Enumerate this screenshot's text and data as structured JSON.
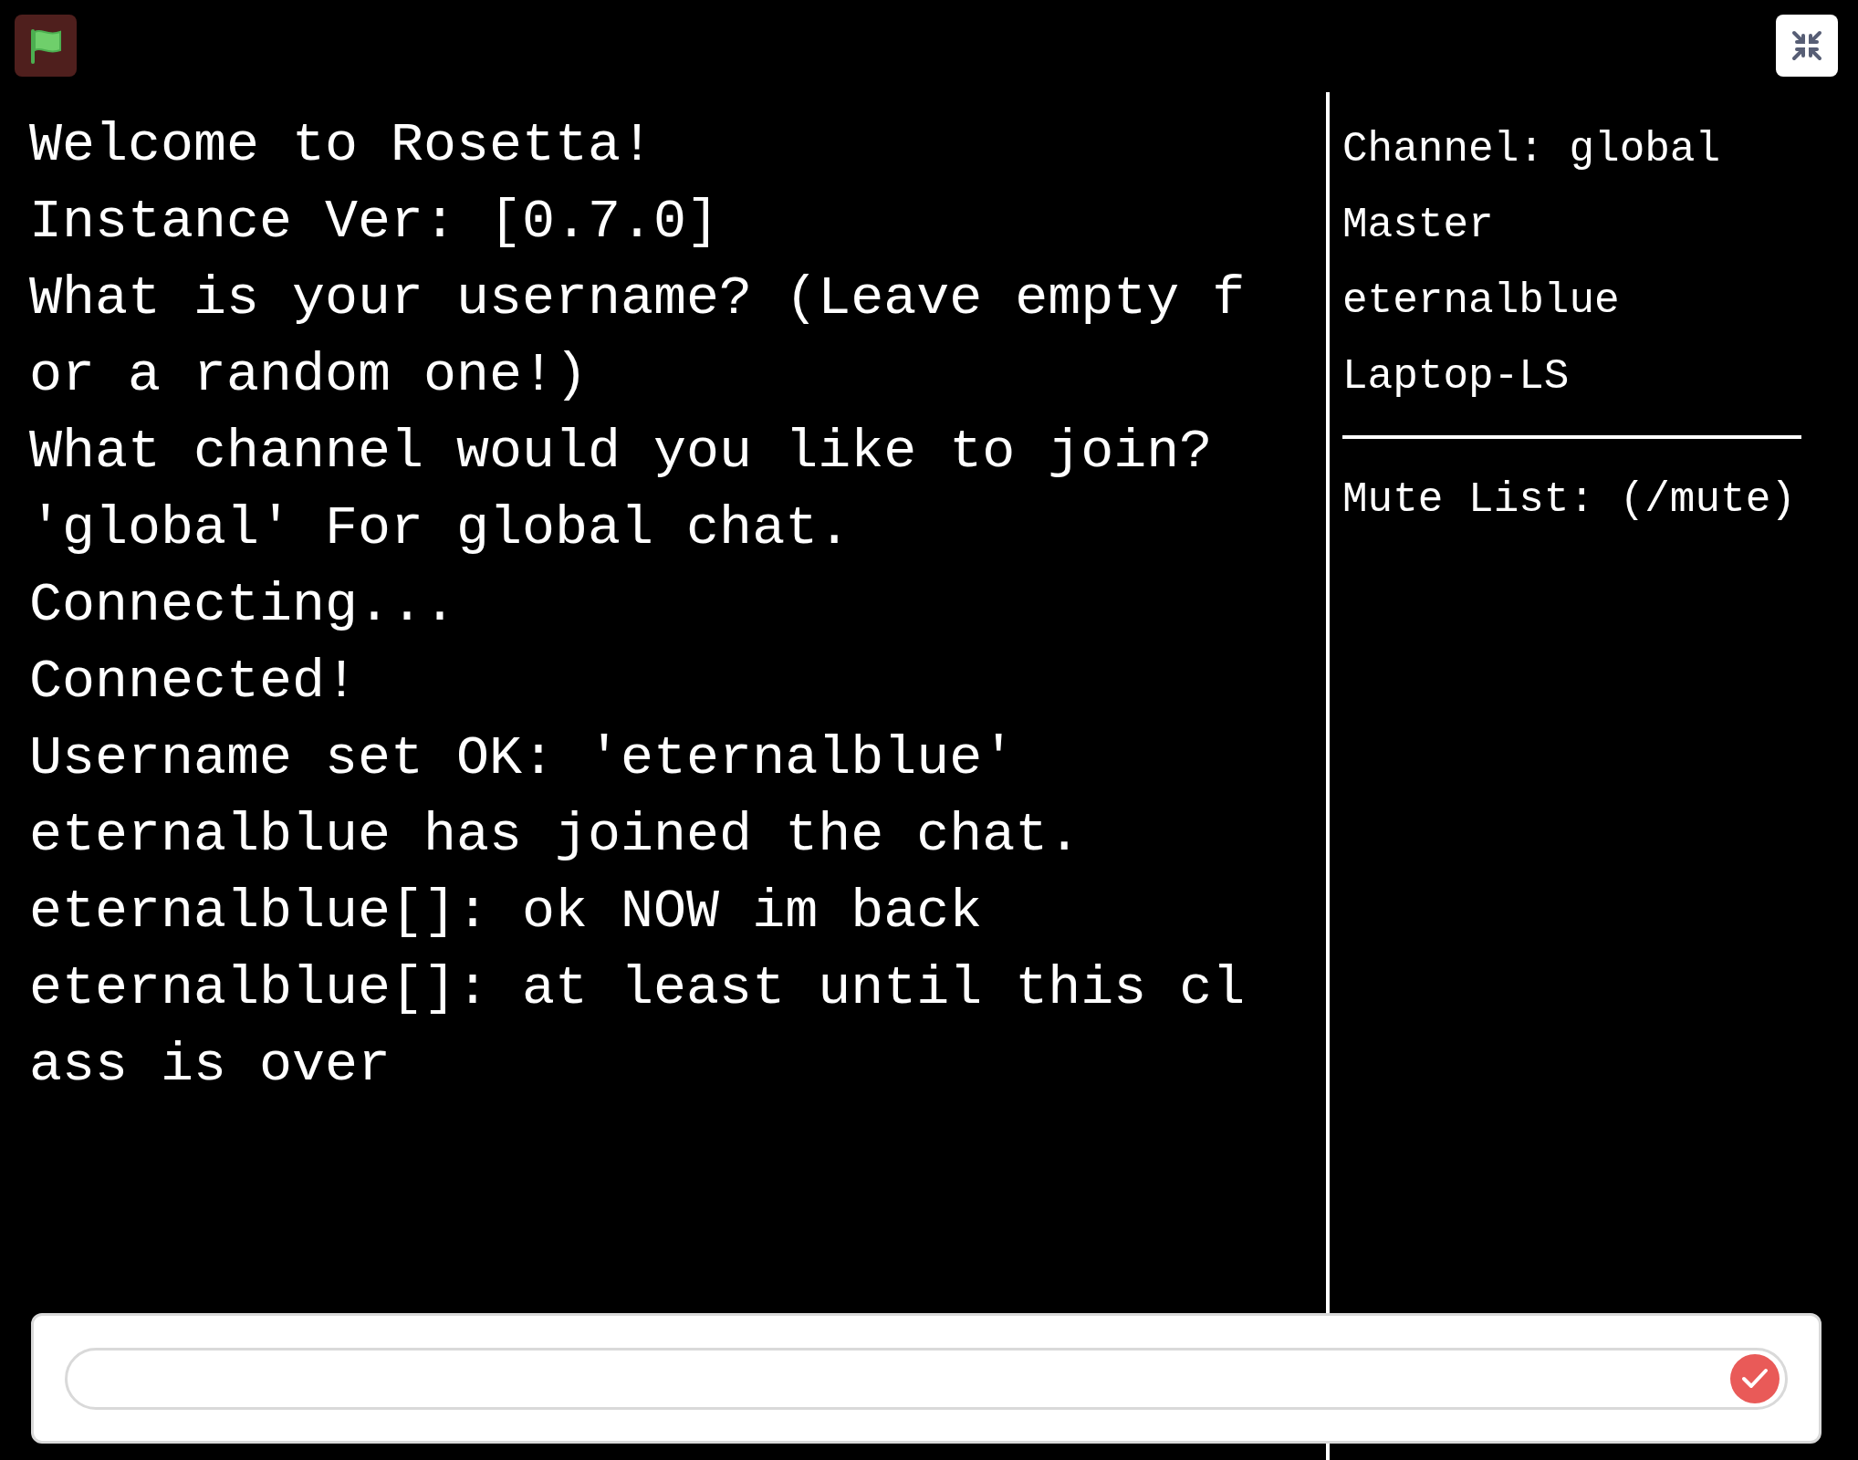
{
  "log": {
    "lines": [
      "Welcome to Rosetta!",
      "Instance Ver: [0.7.0]",
      "What is your username? (Leave empty f",
      "or a random one!)",
      "What channel would you like to join?",
      "'global' For global chat.",
      "Connecting...",
      "Connected!",
      "Username set OK: 'eternalblue'",
      "eternalblue has joined the chat.",
      "eternalblue[]: ok NOW im back",
      "eternalblue[]: at least until this cl",
      "ass is over"
    ]
  },
  "sidebar": {
    "info": [
      "Channel: global",
      "Master",
      "eternalblue",
      "Laptop-LS"
    ],
    "mute_list_label": "Mute List: (/mute)"
  }
}
